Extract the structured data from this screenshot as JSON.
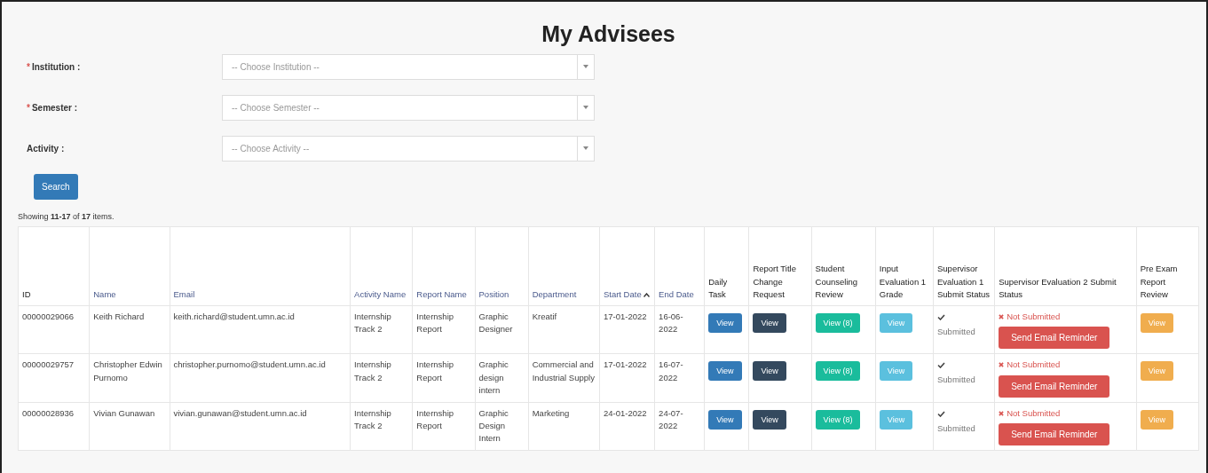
{
  "title": "My Advisees",
  "filters": [
    {
      "label": "Institution :",
      "required": true,
      "placeholder": "-- Choose Institution --"
    },
    {
      "label": "Semester :",
      "required": true,
      "placeholder": "-- Choose Semester --"
    },
    {
      "label": "Activity :",
      "required": false,
      "placeholder": "-- Choose Activity --"
    }
  ],
  "required_mark": "*",
  "search_button": "Search",
  "summary": "Showing **11-17** of **17** items.",
  "columns": [
    {
      "label": "ID",
      "sortable": false
    },
    {
      "label": "Name",
      "sortable": true
    },
    {
      "label": "Email",
      "sortable": true
    },
    {
      "label": "Activity Name",
      "sortable": true
    },
    {
      "label": "Report Name",
      "sortable": true
    },
    {
      "label": "Position",
      "sortable": true
    },
    {
      "label": "Department",
      "sortable": true
    },
    {
      "label": "Start Date",
      "sortable": true,
      "sorted_ascending": true
    },
    {
      "label": "End Date",
      "sortable": true
    },
    {
      "label": "Daily Task",
      "sortable": false
    },
    {
      "label": "Report Title Change Request",
      "sortable": false
    },
    {
      "label": "Student Counseling Review",
      "sortable": false
    },
    {
      "label": "Input Evaluation 1 Grade",
      "sortable": false
    },
    {
      "label": "Supervisor Evaluation 1 Submit Status",
      "sortable": false
    },
    {
      "label": "Supervisor Evaluation 2 Submit Status",
      "sortable": false
    },
    {
      "label": "Pre Exam Report Review",
      "sortable": false
    }
  ],
  "rows": [
    {
      "cells": [
        "00000029066",
        "Keith Richard",
        "keith.richard@student.umn.ac.id",
        "Internship Track 2",
        "Internship Report",
        "Graphic Designer",
        "Kreatif",
        "17-01-2022",
        "16-06-2022"
      ],
      "actions": [
        {
          "label": "View",
          "kind": "primary"
        },
        {
          "label": "View",
          "kind": "dark"
        },
        {
          "label": "View (8)",
          "kind": "success"
        },
        {
          "label": "View",
          "kind": "info"
        }
      ],
      "supervisor_1": {
        "submitted": true,
        "label": "Submitted"
      },
      "supervisor_2": {
        "submitted": false,
        "label": "Not Submitted",
        "reminder": "Send Email Reminder"
      },
      "pre_exam": {
        "label": "View",
        "kind": "warning"
      }
    },
    {
      "cells": [
        "00000029757",
        "Christopher Edwin Purnomo",
        "christopher.purnomo@student.umn.ac.id",
        "Internship Track 2",
        "Internship Report",
        "Graphic design intern",
        "Commercial and Industrial Supply",
        "17-01-2022",
        "16-07-2022"
      ],
      "actions": [
        {
          "label": "View",
          "kind": "primary"
        },
        {
          "label": "View",
          "kind": "dark"
        },
        {
          "label": "View (8)",
          "kind": "success"
        },
        {
          "label": "View",
          "kind": "info"
        }
      ],
      "supervisor_1": {
        "submitted": true,
        "label": "Submitted"
      },
      "supervisor_2": {
        "submitted": false,
        "label": "Not Submitted",
        "reminder": "Send Email Reminder"
      },
      "pre_exam": {
        "label": "View",
        "kind": "warning"
      }
    },
    {
      "cells": [
        "00000028936",
        "Vivian Gunawan",
        "vivian.gunawan@student.umn.ac.id",
        "Internship Track 2",
        "Internship Report",
        "Graphic Design Intern",
        "Marketing",
        "24-01-2022",
        "24-07-2022"
      ],
      "actions": [
        {
          "label": "View",
          "kind": "primary"
        },
        {
          "label": "View",
          "kind": "dark"
        },
        {
          "label": "View (8)",
          "kind": "success"
        },
        {
          "label": "View",
          "kind": "info"
        }
      ],
      "supervisor_1": {
        "submitted": true,
        "label": "Submitted"
      },
      "supervisor_2": {
        "submitted": false,
        "label": "Not Submitted",
        "reminder": "Send Email Reminder"
      },
      "pre_exam": {
        "label": "View",
        "kind": "warning"
      }
    }
  ]
}
